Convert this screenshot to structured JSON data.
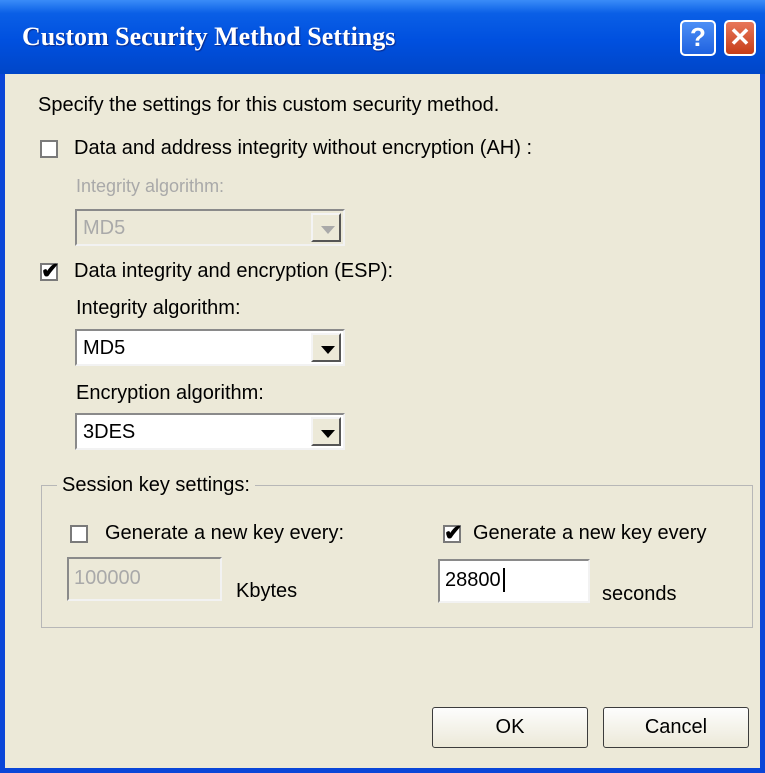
{
  "window": {
    "title": "Custom Security Method Settings",
    "help_glyph": "?",
    "close_glyph": "✕"
  },
  "intro": "Specify the settings for this custom security method.",
  "ah": {
    "checked": false,
    "label": "Data and address integrity without encryption (AH) :",
    "integrity_label": "Integrity algorithm:",
    "integrity_value": "MD5"
  },
  "esp": {
    "checked": true,
    "label": "Data integrity and encryption (ESP):",
    "integrity_label": "Integrity algorithm:",
    "integrity_value": "MD5",
    "encryption_label": "Encryption algorithm:",
    "encryption_value": "3DES"
  },
  "session": {
    "legend": "Session key settings:",
    "kb": {
      "checked": false,
      "label": "Generate a new key every:",
      "value": "100000",
      "unit": "Kbytes"
    },
    "sec": {
      "checked": true,
      "label": "Generate a new key every",
      "value": "28800",
      "unit": "seconds"
    }
  },
  "buttons": {
    "ok": "OK",
    "cancel": "Cancel"
  },
  "icons": {
    "check": "✔"
  }
}
